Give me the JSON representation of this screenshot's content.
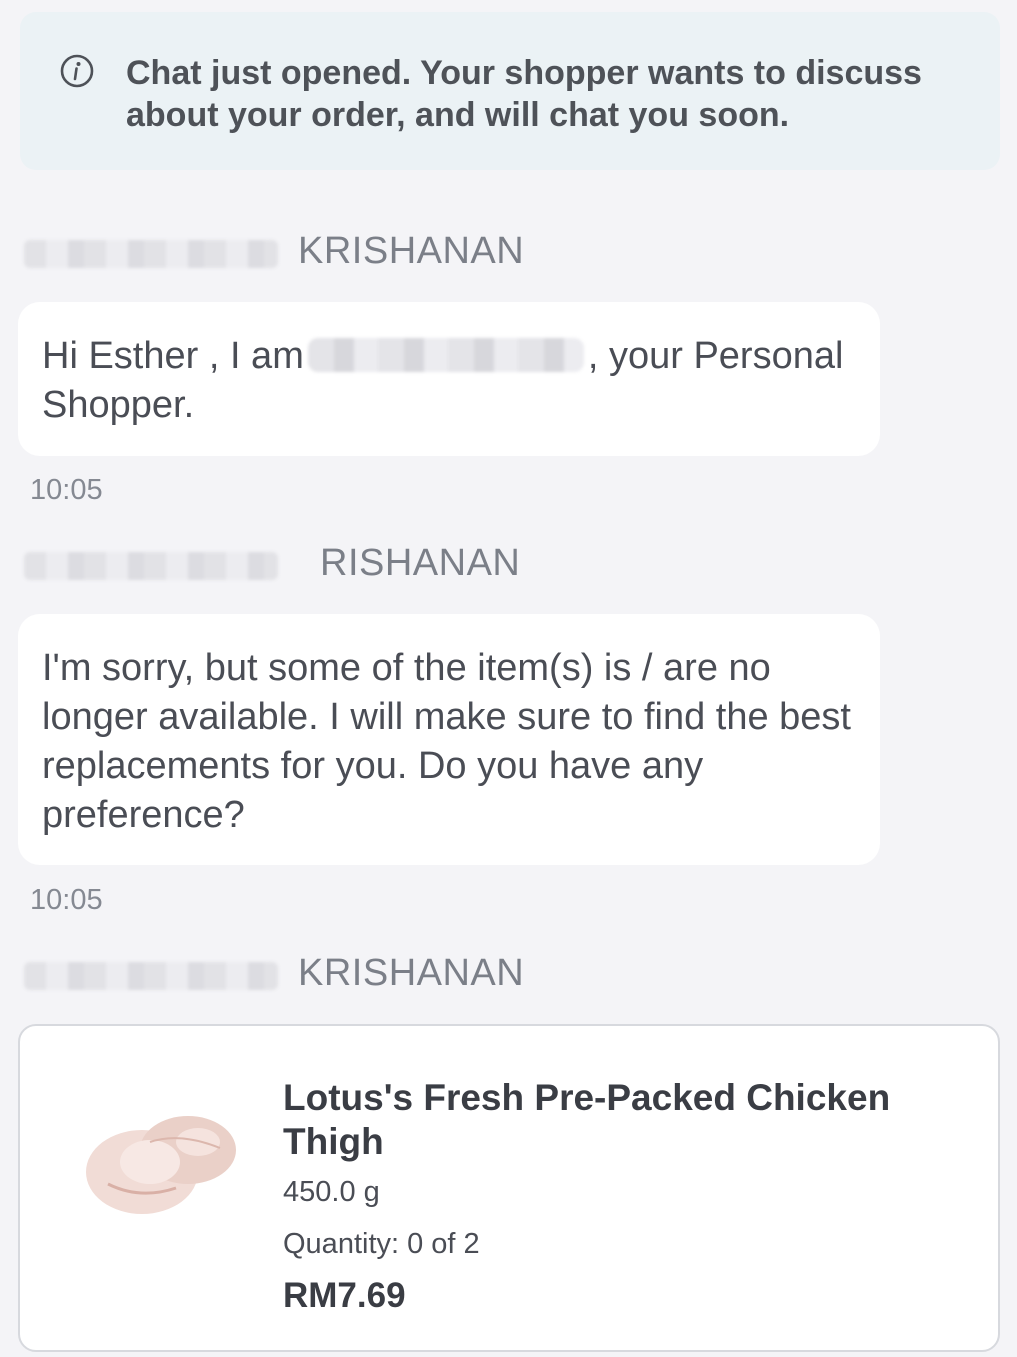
{
  "notice": {
    "icon": "info-circle-icon",
    "text": "Chat just opened. Your shopper wants to discuss about your order, and will chat you soon."
  },
  "messages": [
    {
      "sender": "KRISHANAN",
      "text_before": "Hi Esther , I am",
      "text_after": ", your Personal Shopper.",
      "time": "10:05"
    },
    {
      "sender": "RISHANAN",
      "text": "I'm sorry, but some of the item(s) is / are no longer available. I will make sure to find the best replacements for you. Do you have any preference?",
      "time": "10:05"
    },
    {
      "sender": "KRISHANAN"
    }
  ],
  "product": {
    "image": "chicken-thigh-image",
    "name": "Lotus's Fresh Pre-Packed Chicken Thigh",
    "weight": "450.0 g",
    "quantity": "Quantity: 0 of 2",
    "price": "RM7.69"
  },
  "colors": {
    "background": "#f4f4f7",
    "notice_bg": "#ebf2f5",
    "bubble_bg": "#ffffff",
    "sender": "#7b7f88"
  }
}
